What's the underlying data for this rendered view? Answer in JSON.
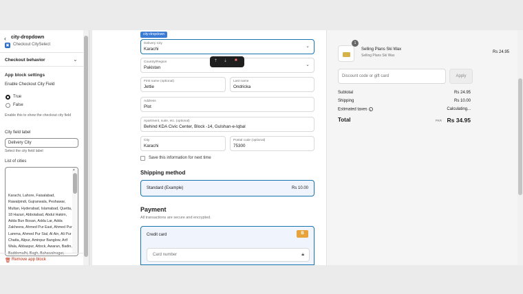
{
  "sidebar": {
    "title": "city-dropdown",
    "app_name": "Checkout CitySelect",
    "checkout_behavior": "Checkout behavior",
    "app_block_settings": "App block settings",
    "enable_field_label": "Enable Checkout City Field",
    "radio_true": "True",
    "radio_false": "False",
    "enable_help": "Enable this to show the checkout city field",
    "city_field_label_title": "City field label",
    "city_field_label_value": "Delivery City",
    "city_field_help": "Select the city field label",
    "list_title": "List of cities",
    "cities_text": "Karachi, Lahore, Faisalabad, Rawalpindi, Gujranwala, Peshawar, Multan, Hyderabad, Islamabad, Quetta, 18 Hazari, Abbotabad, Abdul Hakim, Adda Bun Bosan, Adda Lar, Adda Zakheera, Ahmed Pur East, Ahmed Pur Lamma, Ahmed Pur Sial, Al Ain, Ali Pur Chatta, Alipur, Aminpur Banglow, Arif Wala, Abbaspur, Attock, Awaran, Badin, Baddomalhi, Bagh, Bahawalnagar,",
    "remove_block": "Remove app block"
  },
  "form": {
    "block_tag": "city-dropdown",
    "delivery_city_label": "Delivery City",
    "delivery_city_value": "Karachi",
    "country_label": "Country/Region",
    "country_value": "Pakistan",
    "first_name_label": "First name (optional)",
    "first_name_value": "Jettie",
    "last_name_label": "Last name",
    "last_name_value": "Ondricka",
    "address_label": "Address",
    "address_value": "Plot",
    "apartment_label": "Apartment, suite, etc. (optional)",
    "apartment_value": "Behind KDA Civic Center, Block -14, Gulshan-e-Iqbal",
    "city_label": "City",
    "city_value": "Karachi",
    "postal_label": "Postal code (optional)",
    "postal_value": "75300",
    "save_info": "Save this information for next time",
    "shipping_method_title": "Shipping method",
    "shipping_name": "Standard (Example)",
    "shipping_price": "Rs 10.00",
    "payment_title": "Payment",
    "payment_sub": "All transactions are secure and encrypted.",
    "credit_card": "Credit card",
    "card_badge": "B",
    "card_number_placeholder": "Card number"
  },
  "summary": {
    "product_qty": "1",
    "product_name": "Selling Plans Ski Wax",
    "product_variant": "Selling Plans Ski Wax",
    "product_price": "Rs 24.95",
    "discount_placeholder": "Discount code or gift card",
    "apply": "Apply",
    "subtotal_label": "Subtotal",
    "subtotal_value": "Rs 24.95",
    "shipping_label": "Shipping",
    "shipping_value": "Rs 10.00",
    "taxes_label": "Estimated taxes",
    "taxes_value": "Calculating...",
    "total_label": "Total",
    "total_currency": "PKR",
    "total_value": "Rs 34.95"
  },
  "colors": {
    "accent": "#1773b0",
    "danger": "#c5280c"
  }
}
